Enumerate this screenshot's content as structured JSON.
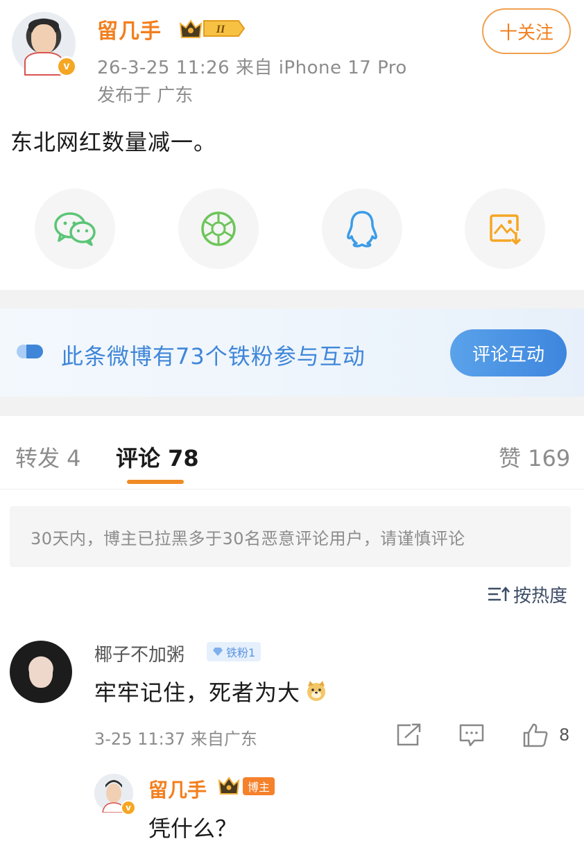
{
  "post": {
    "username": "留几手",
    "time_source": "26-3-25 11:26  来自 iPhone 17 Pro",
    "location": "发布于 广东",
    "follow_label": "十关注",
    "text": "东北网红数量减一。",
    "crown_level": "II"
  },
  "share": {
    "items": [
      {
        "icon": "wechat-icon",
        "color": "#5bc577"
      },
      {
        "icon": "moments-icon",
        "color": "#6dc55a"
      },
      {
        "icon": "qq-icon",
        "color": "#3a9ce8"
      },
      {
        "icon": "save-image-icon",
        "color": "#f5a623"
      }
    ]
  },
  "fans_banner": {
    "text": "此条微博有73个铁粉参与互动",
    "button": "评论互动"
  },
  "tabs": {
    "repost": "转发 4",
    "comments": "评论 78",
    "likes": "赞 169"
  },
  "notice": "30天内，博主已拉黑多于30名恶意评论用户，请谨慎评论",
  "sort_label": "按热度",
  "comment": {
    "username": "椰子不加粥",
    "fan_badge": "铁粉1",
    "text": "牢牢记住，死者为大",
    "meta": "3-25 11:37  来自广东",
    "like_count": "8"
  },
  "reply": {
    "username": "留几手",
    "host_badge": "博主",
    "text": "凭什么？"
  },
  "colors": {
    "brand_orange": "#f27f1e",
    "link_blue": "#3f86d8",
    "muted": "#8c8c8c"
  }
}
